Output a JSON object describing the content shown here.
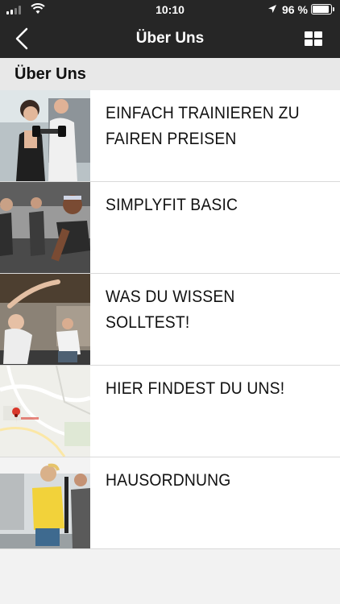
{
  "status_bar": {
    "time": "10:10",
    "battery_percent": "96 %",
    "battery_level": 0.96
  },
  "nav": {
    "title": "Über Uns",
    "back_icon": "chevron-left-icon",
    "menu_icon": "grid-icon"
  },
  "section": {
    "title": "Über Uns"
  },
  "items": [
    {
      "label": "EINFACH TRAINIEREN ZU FAIREN PREISEN",
      "thumb": "gym-trainer-photo"
    },
    {
      "label": "SIMPLYFIT BASIC",
      "thumb": "treadmill-runners-photo"
    },
    {
      "label": "WAS DU WISSEN SOLLTEST!",
      "thumb": "stretching-photo"
    },
    {
      "label": "HIER FINDEST DU UNS!",
      "thumb": "map-photo"
    },
    {
      "label": "HAUSORDNUNG",
      "thumb": "cable-workout-photo"
    }
  ],
  "colors": {
    "header_bg": "#262626",
    "section_bg": "#e8e8e8",
    "page_bg": "#f2f2f2",
    "map_pin": "#d9382b"
  }
}
